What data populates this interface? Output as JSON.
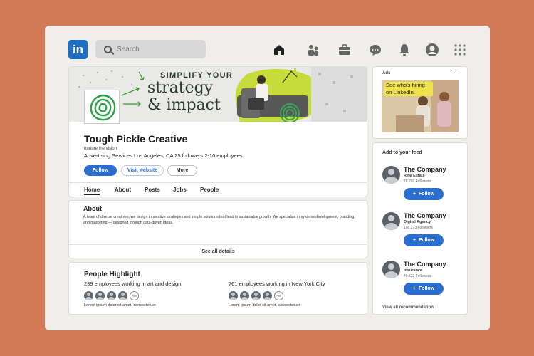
{
  "nav": {
    "logo": "in",
    "search_placeholder": "Search",
    "icons": [
      "home-icon",
      "people-icon",
      "briefcase-icon",
      "messaging-icon",
      "bell-icon",
      "profile-icon",
      "apps-grid-icon"
    ]
  },
  "banner": {
    "headline_small": "SIMPLIFY YOUR",
    "headline_line1": "strategy",
    "headline_line2": "& impact"
  },
  "company": {
    "name": "Tough Pickle Creative",
    "tagline": "nurture the vision",
    "meta": "Advertising Services Los Angeles, CA 25 followers 2-10 employees",
    "buttons": {
      "follow": "Follow",
      "website": "Visit website",
      "more": "More"
    },
    "tabs": [
      "Home",
      "About",
      "Posts",
      "Jobs",
      "People"
    ]
  },
  "about": {
    "title": "About",
    "text": "A team of diverse creatives, we design innovative strategies and simple solutions that lead to sustainable growth. We specialize in systems development, branding, and marketing — designed through data-driven ideas.",
    "see_all": "See all details"
  },
  "people": {
    "title": "People Highlight",
    "left": {
      "summary": "239 employees working in art and design",
      "more": "+89",
      "note": "Lorem ipsum dolor sit amet, consectetuer"
    },
    "right": {
      "summary": "761 employees working in New York City",
      "more": "+89",
      "note": "Lorem ipsum dolor sit amet, consectetuer"
    }
  },
  "ads": {
    "label": "Ads",
    "menu": "···",
    "ad_text": "See who's hiring on LinkedIn."
  },
  "feed": {
    "title": "Add to your feed",
    "items": [
      {
        "name": "The Company",
        "category": "Real Estate",
        "followers": "78.292 Followers",
        "button": "Follow"
      },
      {
        "name": "The Company",
        "category": "Digital Agency",
        "followers": "108.273 Followers",
        "button": "Follow"
      },
      {
        "name": "The Company",
        "category": "Insurance",
        "followers": "49.532 Followers",
        "button": "Follow"
      }
    ],
    "view_all": "View all recommendation"
  },
  "colors": {
    "background": "#d47a57",
    "brand": "#1d6fc4",
    "button": "#2a6fd0",
    "accent_green": "#c5dc3a"
  }
}
